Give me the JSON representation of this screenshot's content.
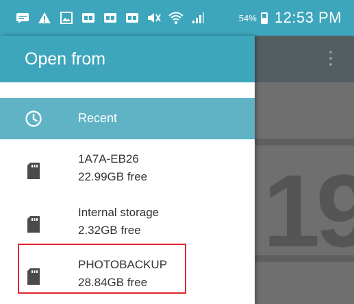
{
  "status_bar": {
    "battery_percent": "54%",
    "time": "12:53 PM",
    "icons": [
      "message-icon",
      "warning-icon",
      "image-icon",
      "sim-icon",
      "sim-icon",
      "sim-icon",
      "mute-icon",
      "wifi-icon",
      "signal-icon",
      "battery-icon"
    ]
  },
  "drawer": {
    "title": "Open from",
    "recent": {
      "label": "Recent",
      "icon": "clock-icon"
    },
    "storage": [
      {
        "name": "1A7A-EB26",
        "free": "22.99GB free",
        "icon": "sd-card-icon"
      },
      {
        "name": "Internal storage",
        "free": "2.32GB free",
        "icon": "sd-card-icon"
      },
      {
        "name": "PHOTOBACKUP",
        "free": "28.84GB free",
        "icon": "sd-card-icon"
      }
    ]
  },
  "background_app": {
    "content_text": "19"
  },
  "colors": {
    "accent": "#3ea6bc",
    "selected_item": "#5fb3c5",
    "highlight": "#e0262b"
  }
}
